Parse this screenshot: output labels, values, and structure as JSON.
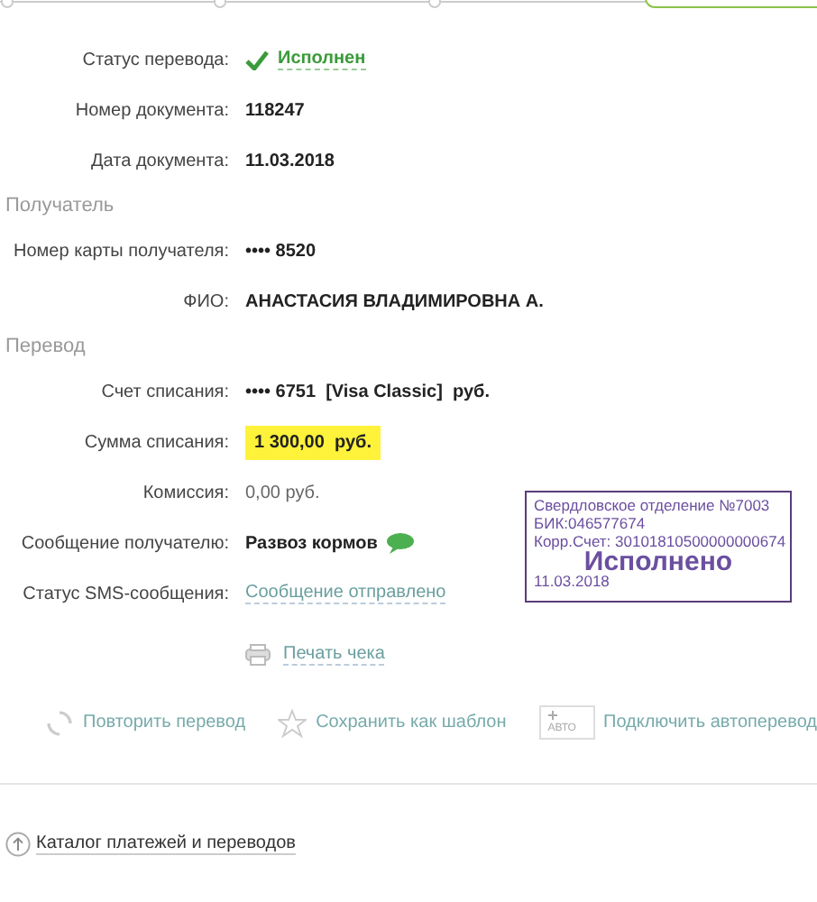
{
  "details": [
    {
      "label": "Статус перевода:",
      "value": "Исполнен",
      "kind": "status"
    },
    {
      "label": "Номер документа:",
      "value": "118247",
      "kind": "bold"
    },
    {
      "label": "Дата документа:",
      "value": "11.03.2018",
      "kind": "bold"
    }
  ],
  "recipient": {
    "title": "Получатель",
    "rows": [
      {
        "label": "Номер карты получателя:",
        "value": "•••• 8520",
        "kind": "bold"
      },
      {
        "label": "ФИО:",
        "value": "АНАСТАСИЯ ВЛАДИМИРОВНА А.",
        "kind": "bold"
      }
    ]
  },
  "transfer": {
    "title": "Перевод",
    "rows": [
      {
        "label": "Счет списания:",
        "value": "•••• 6751  [Visa Classic]  руб.",
        "kind": "bold"
      },
      {
        "label": "Сумма списания:",
        "value": "1 300,00  руб.",
        "kind": "highlight"
      },
      {
        "label": "Комиссия:",
        "value": "0,00 руб.",
        "kind": "plain"
      },
      {
        "label": "Сообщение получателю:",
        "value": "Развоз кормов",
        "kind": "message"
      },
      {
        "label": "Статус SMS-сообщения:",
        "value": "Сообщение отправлено",
        "kind": "link"
      }
    ]
  },
  "stamp": {
    "lines": [
      "Свердловское отделение №7003",
      "БИК:046577674",
      "Корр.Счет: 30101810500000000674"
    ],
    "title": "Исполнено",
    "date": "11.03.2018"
  },
  "print_link": "Печать чека",
  "actions": [
    {
      "label": "Повторить перевод",
      "kind": "repeat"
    },
    {
      "label": "Сохранить как шаблон",
      "kind": "star"
    },
    {
      "label": "Подключить автоперевод",
      "kind": "auto",
      "badge": "АВТО"
    }
  ],
  "catalog_link": "Каталог платежей и переводов"
}
